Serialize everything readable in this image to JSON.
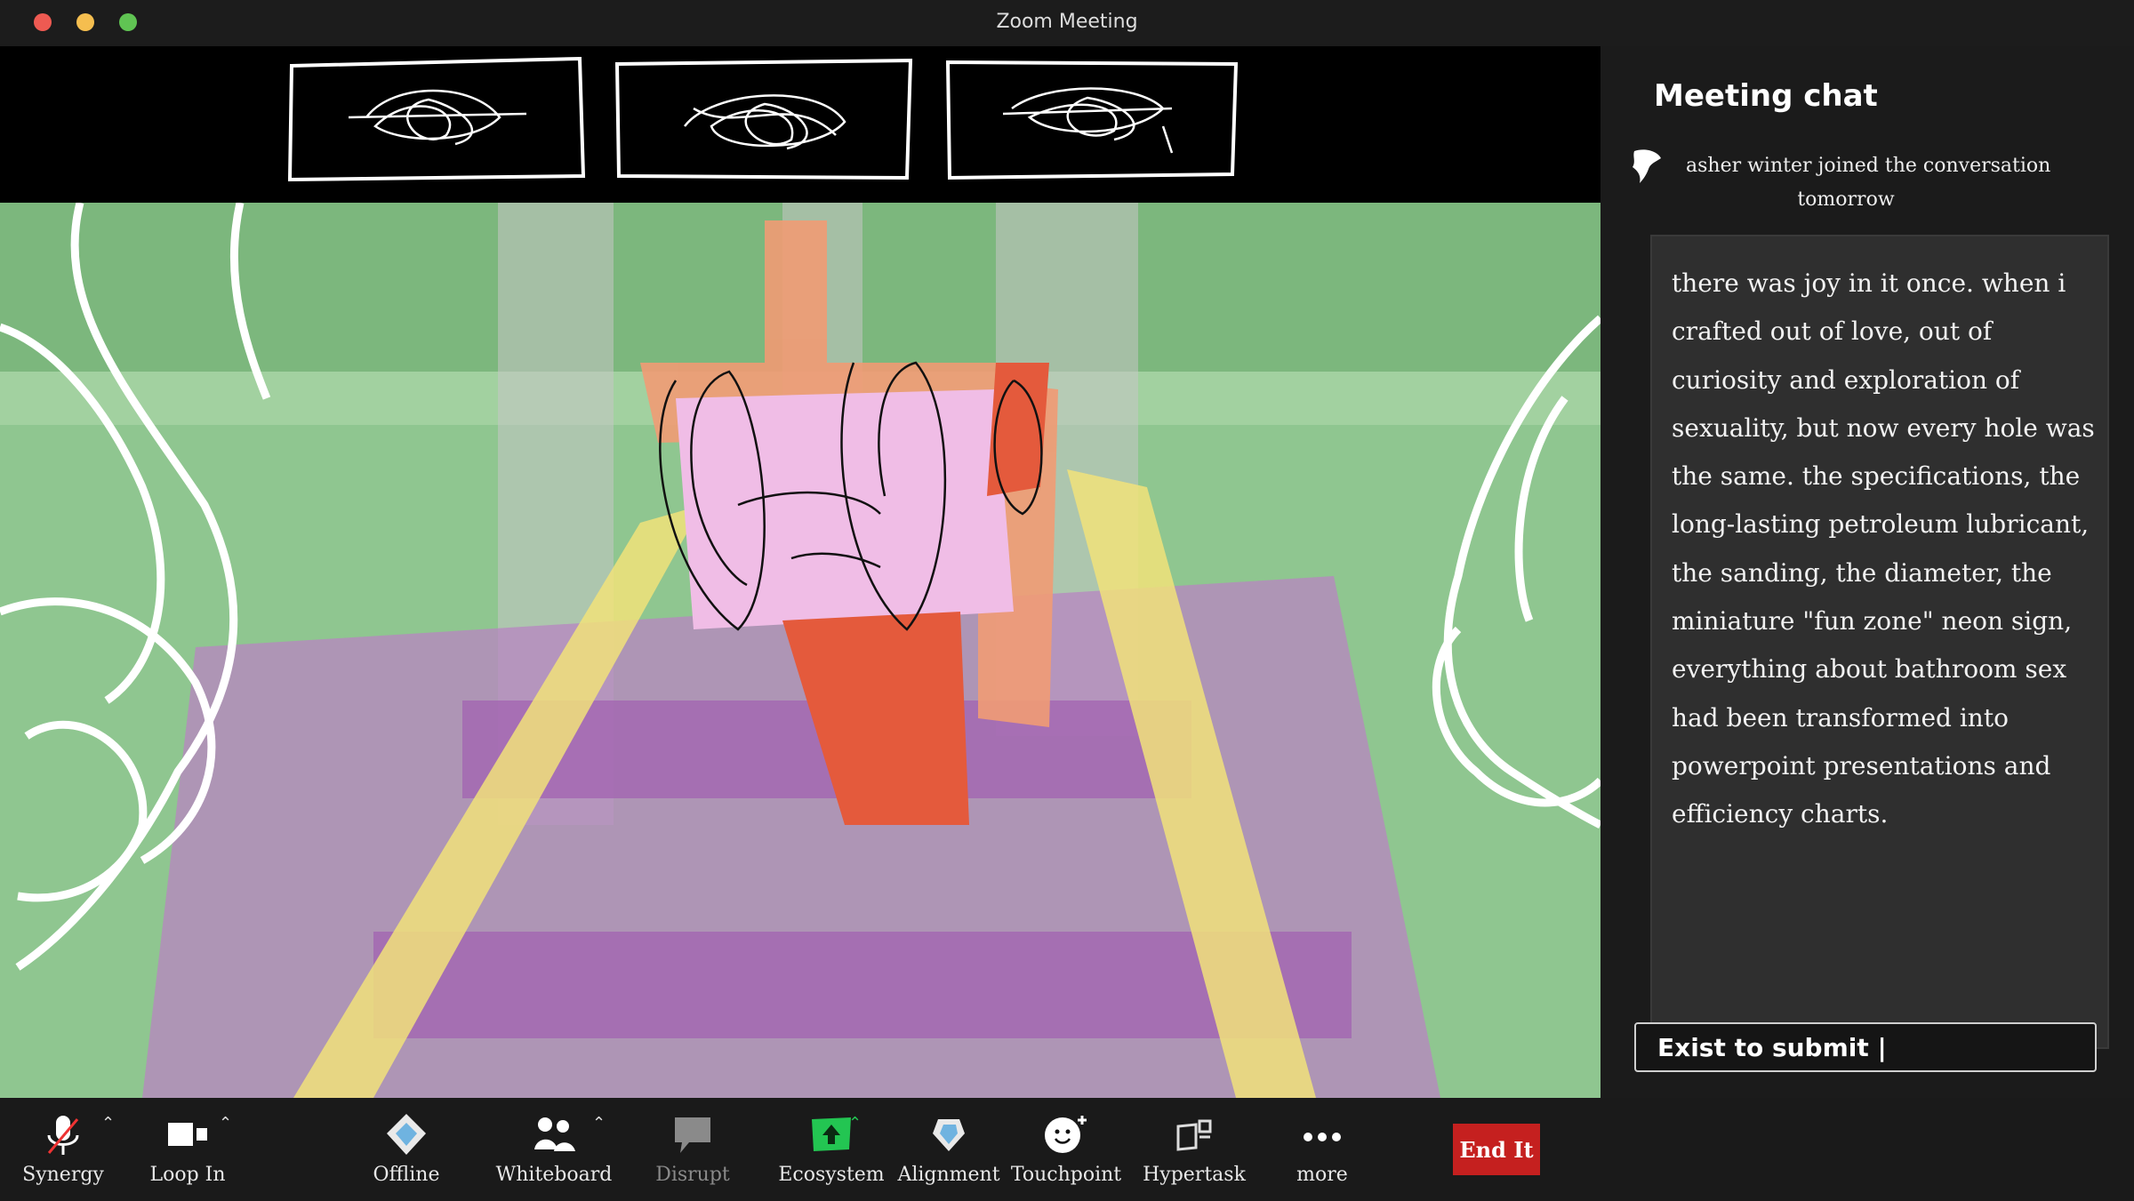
{
  "window": {
    "title": "Zoom Meeting"
  },
  "chat": {
    "title": "Meeting chat",
    "join_notice": {
      "line1": "asher winter  joined the conversation",
      "line2": "tomorrow"
    },
    "message": "there was joy in it once. when i crafted out of love, out of curiosity and exploration of sexuality, but now every hole was the same. the specifications, the long-lasting petroleum lubricant, the sanding, the diameter, the miniature \"fun zone\" neon sign, everything about bathroom sex had been transformed into powerpoint presentations and efficiency charts.",
    "input": {
      "value": "Exist to submit |"
    }
  },
  "toolbar": {
    "items": [
      {
        "label": "Synergy",
        "icon": "muted-microphone-icon",
        "caret": true
      },
      {
        "label": "Loop In",
        "icon": "video-camera-icon",
        "caret": true
      },
      {
        "label": "Offline",
        "icon": "shield-diamond-icon",
        "caret": false
      },
      {
        "label": "Whiteboard",
        "icon": "participants-icon",
        "caret": true
      },
      {
        "label": "Disrupt",
        "icon": "speech-bubble-icon",
        "caret": false,
        "dim": true
      },
      {
        "label": "Ecosystem",
        "icon": "share-screen-icon",
        "caret": true,
        "accent": "#23c552"
      },
      {
        "label": "Alignment",
        "icon": "heart-shield-icon",
        "caret": false
      },
      {
        "label": "Touchpoint",
        "icon": "smiley-add-icon",
        "caret": false
      },
      {
        "label": "Hypertask",
        "icon": "apps-icon",
        "caret": false
      },
      {
        "label": "more",
        "icon": "more-dots-icon",
        "caret": false
      }
    ],
    "end_label": "End It"
  },
  "colors": {
    "end_button": "#c5201f",
    "video_green": "#8fc690",
    "chat_bubble": "#2f2f2f"
  }
}
